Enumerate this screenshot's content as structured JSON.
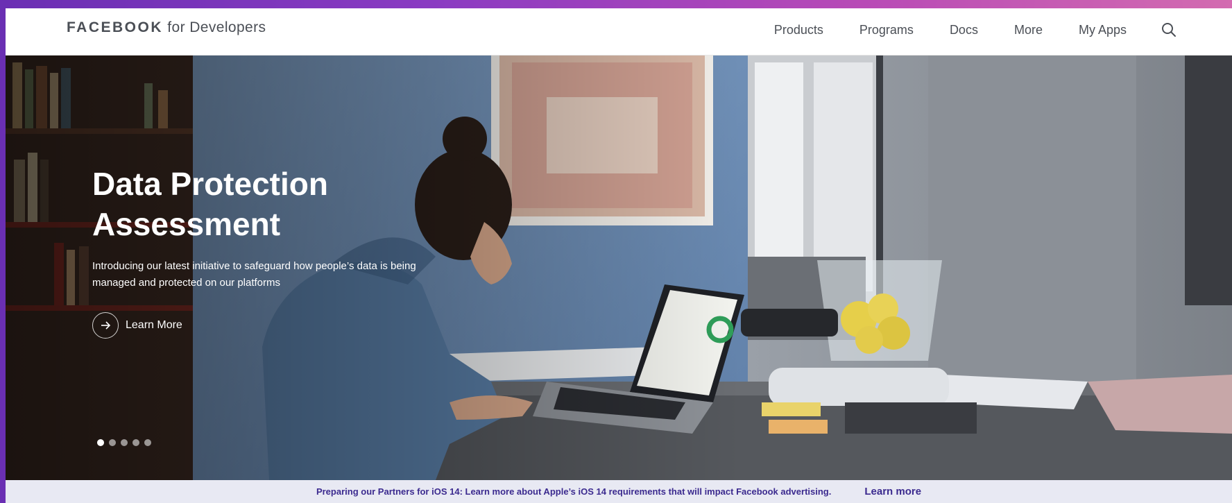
{
  "header": {
    "logo_brand": "FACEBOOK",
    "logo_rest": " for Developers",
    "nav": [
      {
        "label": "Products"
      },
      {
        "label": "Programs"
      },
      {
        "label": "Docs"
      },
      {
        "label": "More"
      },
      {
        "label": "My Apps"
      }
    ],
    "search_icon": "search-icon"
  },
  "hero": {
    "title": "Data Protection Assessment",
    "description": "Introducing our latest initiative to safeguard how people’s data is being managed and protected on our platforms",
    "cta_label": "Learn More",
    "cta_icon": "arrow-right-icon",
    "carousel_count": 5,
    "carousel_active": 1
  },
  "banner": {
    "text": "Preparing our Partners for iOS 14: Learn more about Apple’s iOS 14 requirements that will impact Facebook advertising.",
    "link": "Learn more"
  },
  "colors": {
    "frame_gradient_start": "#6a2fb3",
    "frame_gradient_end": "#d36bb0",
    "banner_bg": "#e8e9f3",
    "banner_text": "#3b2a8f",
    "nav_text": "#4b4f56"
  }
}
